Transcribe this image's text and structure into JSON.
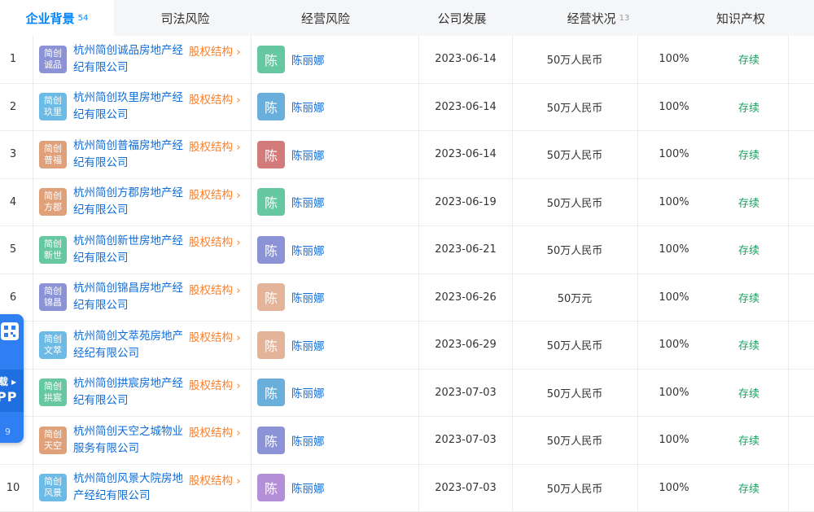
{
  "tabs": [
    {
      "label": "企业背景",
      "count": "54",
      "active": true
    },
    {
      "label": "司法风险",
      "count": ""
    },
    {
      "label": "经营风险",
      "count": ""
    },
    {
      "label": "公司发展",
      "count": ""
    },
    {
      "label": "经营状况",
      "count": "13"
    },
    {
      "label": "知识产权",
      "count": ""
    }
  ],
  "equity_label": "股权结构 ›",
  "chart_data": {
    "type": "table",
    "rows": [
      {
        "idx": "1",
        "logo": [
          "简创",
          "诚品"
        ],
        "logo_color": "#8b93d6",
        "company": "杭州简创诚品房地产经纪有限公司",
        "avatar": "陈",
        "avatar_color": "#66c8a0",
        "person": "陈丽娜",
        "date": "2023-06-14",
        "capital": "50万人民币",
        "ratio": "100%",
        "status": "存续"
      },
      {
        "idx": "2",
        "logo": [
          "简创",
          "玖里"
        ],
        "logo_color": "#6cbbe6",
        "company": "杭州简创玖里房地产经纪有限公司",
        "avatar": "陈",
        "avatar_color": "#6aaedb",
        "person": "陈丽娜",
        "date": "2023-06-14",
        "capital": "50万人民币",
        "ratio": "100%",
        "status": "存续"
      },
      {
        "idx": "3",
        "logo": [
          "简创",
          "普福"
        ],
        "logo_color": "#e0a17a",
        "company": "杭州简创普福房地产经纪有限公司",
        "avatar": "陈",
        "avatar_color": "#d37b7b",
        "person": "陈丽娜",
        "date": "2023-06-14",
        "capital": "50万人民币",
        "ratio": "100%",
        "status": "存续"
      },
      {
        "idx": "4",
        "logo": [
          "简创",
          "方郡"
        ],
        "logo_color": "#e0a17a",
        "company": "杭州简创方郡房地产经纪有限公司",
        "avatar": "陈",
        "avatar_color": "#66c8a0",
        "person": "陈丽娜",
        "date": "2023-06-19",
        "capital": "50万人民币",
        "ratio": "100%",
        "status": "存续"
      },
      {
        "idx": "5",
        "logo": [
          "简创",
          "新世"
        ],
        "logo_color": "#66c8a0",
        "company": "杭州简创新世房地产经纪有限公司",
        "avatar": "陈",
        "avatar_color": "#8b93d6",
        "person": "陈丽娜",
        "date": "2023-06-21",
        "capital": "50万人民币",
        "ratio": "100%",
        "status": "存续"
      },
      {
        "idx": "6",
        "logo": [
          "简创",
          "锦昌"
        ],
        "logo_color": "#8b93d6",
        "company": "杭州简创锦昌房地产经纪有限公司",
        "avatar": "陈",
        "avatar_color": "#e3b49a",
        "person": "陈丽娜",
        "date": "2023-06-26",
        "capital": "50万元",
        "ratio": "100%",
        "status": "存续"
      },
      {
        "idx": "7",
        "logo": [
          "简创",
          "文萃"
        ],
        "logo_color": "#6cbbe6",
        "company": "杭州简创文萃苑房地产经纪有限公司",
        "avatar": "陈",
        "avatar_color": "#e3b49a",
        "person": "陈丽娜",
        "date": "2023-06-29",
        "capital": "50万人民币",
        "ratio": "100%",
        "status": "存续"
      },
      {
        "idx": "8",
        "logo": [
          "简创",
          "拱宸"
        ],
        "logo_color": "#66c8a0",
        "company": "杭州简创拱宸房地产经纪有限公司",
        "avatar": "陈",
        "avatar_color": "#6aaedb",
        "person": "陈丽娜",
        "date": "2023-07-03",
        "capital": "50万人民币",
        "ratio": "100%",
        "status": "存续"
      },
      {
        "idx": "9",
        "logo": [
          "简创",
          "天空"
        ],
        "logo_color": "#e0a17a",
        "company": "杭州简创天空之城物业服务有限公司",
        "avatar": "陈",
        "avatar_color": "#8b93d6",
        "person": "陈丽娜",
        "date": "2023-07-03",
        "capital": "50万人民币",
        "ratio": "100%",
        "status": "存续"
      },
      {
        "idx": "10",
        "logo": [
          "简创",
          "风景"
        ],
        "logo_color": "#6cbbe6",
        "company": "杭州简创风景大院房地产经纪有限公司",
        "avatar": "陈",
        "avatar_color": "#b48fd8",
        "person": "陈丽娜",
        "date": "2023-07-03",
        "capital": "50万人民币",
        "ratio": "100%",
        "status": "存续"
      }
    ]
  },
  "float_widget": {
    "line1": "载 ▸",
    "line2": "PP",
    "badge": "9"
  }
}
